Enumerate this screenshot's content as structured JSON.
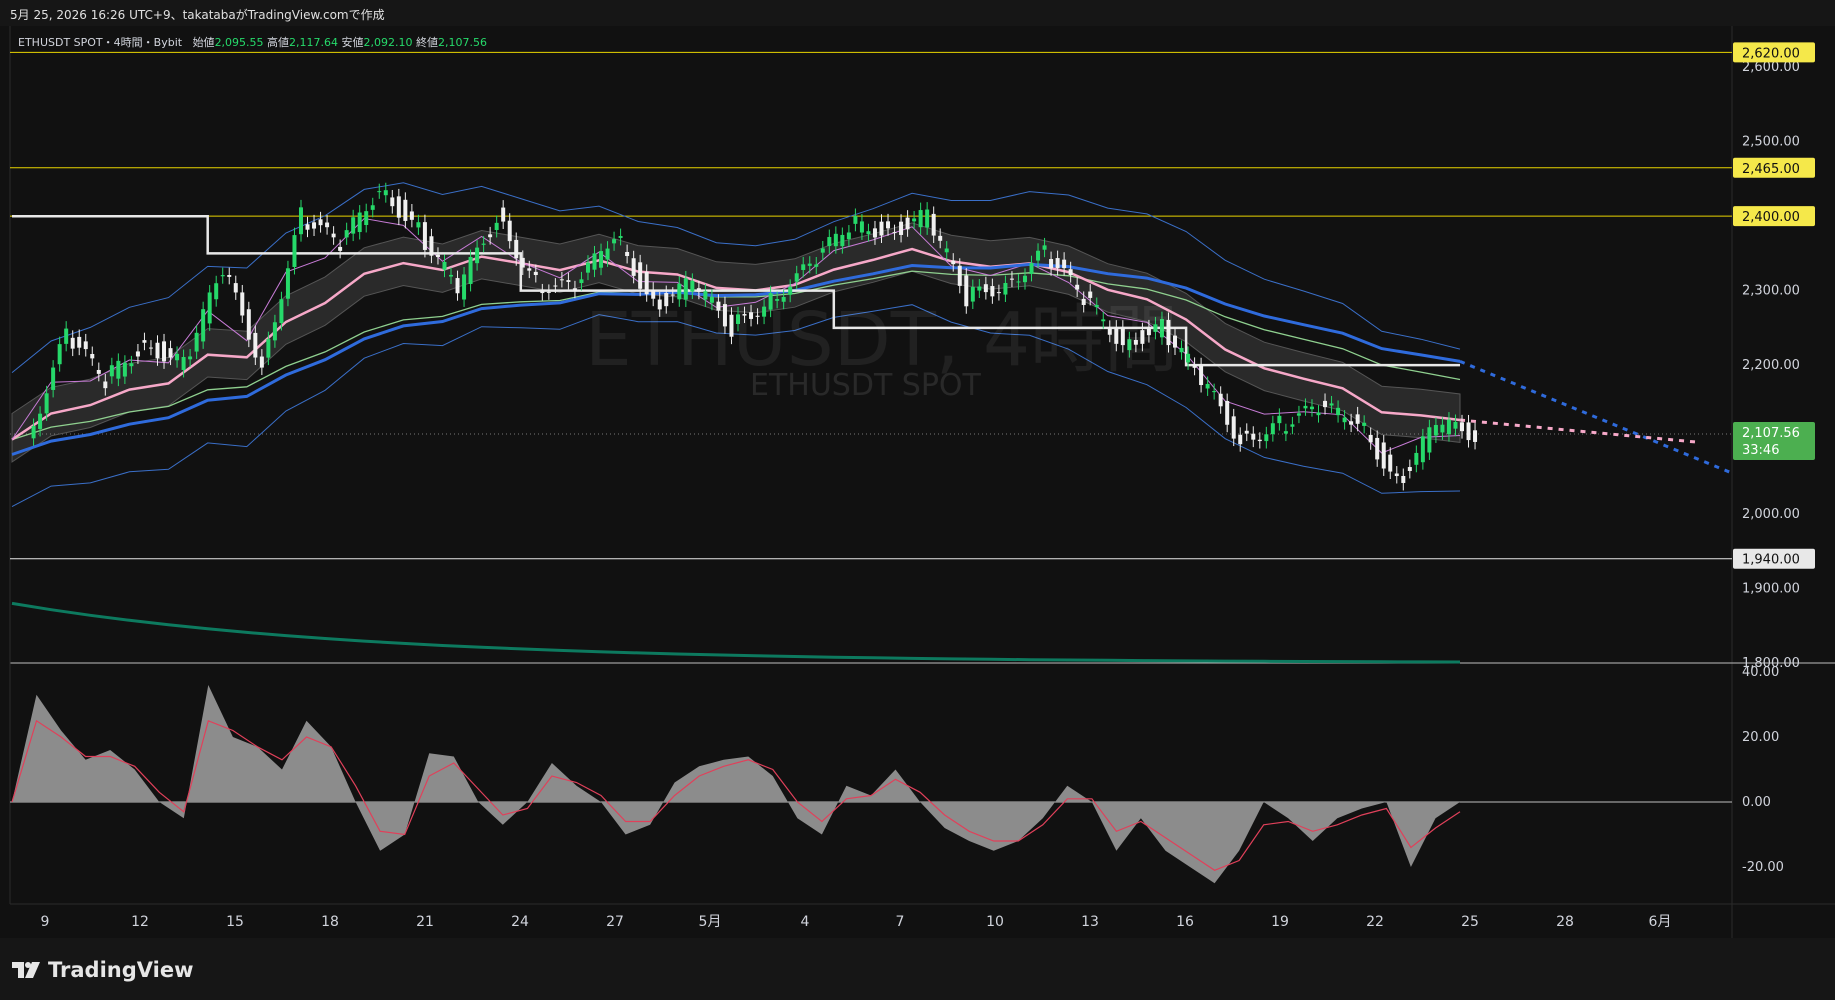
{
  "header": {
    "caption": "5月 25, 2026 16:26 UTC+9、takatabaがTradingView.comで作成"
  },
  "legend": {
    "symbol": "ETHUSDT SPOT・4時間・Bybit",
    "open_label": "始値",
    "open": "2,095.55",
    "high_label": "高値",
    "high": "2,117.64",
    "low_label": "安値",
    "low": "2,092.10",
    "close_label": "終値",
    "close": "2,107.56"
  },
  "watermark": {
    "main": "ETHUSDT, 4時間",
    "sub": "ETHUSDT SPOT"
  },
  "brand": {
    "name": "TradingView"
  },
  "colors": {
    "background": "#111111",
    "up_candle": "#26d96a",
    "down_candle": "#f0f0f0",
    "level_line": "#e8d400",
    "price_tag": "#f5e84a",
    "current_tag": "#4caf50",
    "ema_blue": "#2f6bdc",
    "ma_pink": "#f6a8c8",
    "ma_green": "#8fd08f",
    "bollinger": "#3a6fc8",
    "long_ma": "#0d7a5f",
    "ichimoku_white": "#e8e8e8",
    "oscillator_fill": "#8c8c8c",
    "signal_red": "#e0405a"
  },
  "chart_data": [
    {
      "type": "candlestick",
      "symbol": "ETHUSDT SPOT",
      "timeframe": "4時間",
      "y_axis_ticks": [
        "2,600.00",
        "2,500.00",
        "2,400.00",
        "2,300.00",
        "2,200.00",
        "2,107.56",
        "2,000.00",
        "1,900.00",
        "1,800.00"
      ],
      "ylim": [
        1800,
        2650
      ],
      "x_axis_ticks": [
        "9",
        "12",
        "15",
        "18",
        "21",
        "24",
        "27",
        "5月",
        "4",
        "7",
        "10",
        "13",
        "16",
        "19",
        "22",
        "25",
        "28",
        "6月"
      ],
      "horizontal_levels": [
        {
          "value": 2620,
          "label": "2,620.00"
        },
        {
          "value": 2465,
          "label": "2,465.00"
        },
        {
          "value": 2400,
          "label": "2,400.00"
        },
        {
          "value": 1940,
          "label": "1,940.00"
        }
      ],
      "last_price": {
        "value": 2107.56,
        "label": "2,107.56",
        "countdown": "33:46"
      },
      "close_series": [
        {
          "x": 0,
          "y": 2100
        },
        {
          "x": 1,
          "y": 2240
        },
        {
          "x": 2,
          "y": 2180
        },
        {
          "x": 3,
          "y": 2230
        },
        {
          "x": 4,
          "y": 2200
        },
        {
          "x": 5,
          "y": 2330
        },
        {
          "x": 6,
          "y": 2200
        },
        {
          "x": 7,
          "y": 2400
        },
        {
          "x": 8,
          "y": 2360
        },
        {
          "x": 9,
          "y": 2440
        },
        {
          "x": 10,
          "y": 2380
        },
        {
          "x": 11,
          "y": 2300
        },
        {
          "x": 12,
          "y": 2400
        },
        {
          "x": 13,
          "y": 2310
        },
        {
          "x": 14,
          "y": 2300
        },
        {
          "x": 15,
          "y": 2380
        },
        {
          "x": 16,
          "y": 2280
        },
        {
          "x": 17,
          "y": 2310
        },
        {
          "x": 18,
          "y": 2250
        },
        {
          "x": 19,
          "y": 2290
        },
        {
          "x": 20,
          "y": 2330
        },
        {
          "x": 21,
          "y": 2390
        },
        {
          "x": 22,
          "y": 2380
        },
        {
          "x": 23,
          "y": 2400
        },
        {
          "x": 24,
          "y": 2290
        },
        {
          "x": 25,
          "y": 2310
        },
        {
          "x": 26,
          "y": 2350
        },
        {
          "x": 27,
          "y": 2290
        },
        {
          "x": 28,
          "y": 2230
        },
        {
          "x": 29,
          "y": 2250
        },
        {
          "x": 30,
          "y": 2180
        },
        {
          "x": 31,
          "y": 2100
        },
        {
          "x": 32,
          "y": 2120
        },
        {
          "x": 33,
          "y": 2140
        },
        {
          "x": 34,
          "y": 2130
        },
        {
          "x": 35,
          "y": 2040
        },
        {
          "x": 36,
          "y": 2120
        },
        {
          "x": 37,
          "y": 2107.56
        }
      ]
    },
    {
      "type": "area",
      "pane": "oscillator",
      "y_axis_ticks": [
        "40.00",
        "20.00",
        "0.00",
        "-20.00"
      ],
      "ylim": [
        -30,
        42
      ],
      "values": [
        0,
        33,
        22,
        13,
        16,
        10,
        0,
        -5,
        36,
        20,
        17,
        10,
        25,
        17,
        0,
        -15,
        -10,
        15,
        14,
        0,
        -7,
        0,
        12,
        5,
        0,
        -10,
        -7,
        6,
        11,
        13,
        14,
        8,
        -5,
        -10,
        5,
        2,
        10,
        0,
        -8,
        -12,
        -15,
        -12,
        -5,
        5,
        0,
        -15,
        -5,
        -15,
        -20,
        -25,
        -15,
        0,
        -5,
        -12,
        -5,
        -2,
        0,
        -20,
        -5,
        0
      ],
      "signal": [
        0,
        25,
        20,
        14,
        14,
        11,
        3,
        -3,
        25,
        22,
        17,
        13,
        20,
        17,
        5,
        -9,
        -10,
        8,
        12,
        4,
        -4,
        -2,
        8,
        6,
        2,
        -6,
        -6,
        2,
        8,
        11,
        13,
        10,
        0,
        -6,
        1,
        2,
        7,
        3,
        -4,
        -9,
        -12,
        -12,
        -7,
        1,
        1,
        -9,
        -6,
        -11,
        -16,
        -21,
        -18,
        -7,
        -6,
        -9,
        -7,
        -4,
        -2,
        -14,
        -8,
        -3
      ]
    }
  ]
}
